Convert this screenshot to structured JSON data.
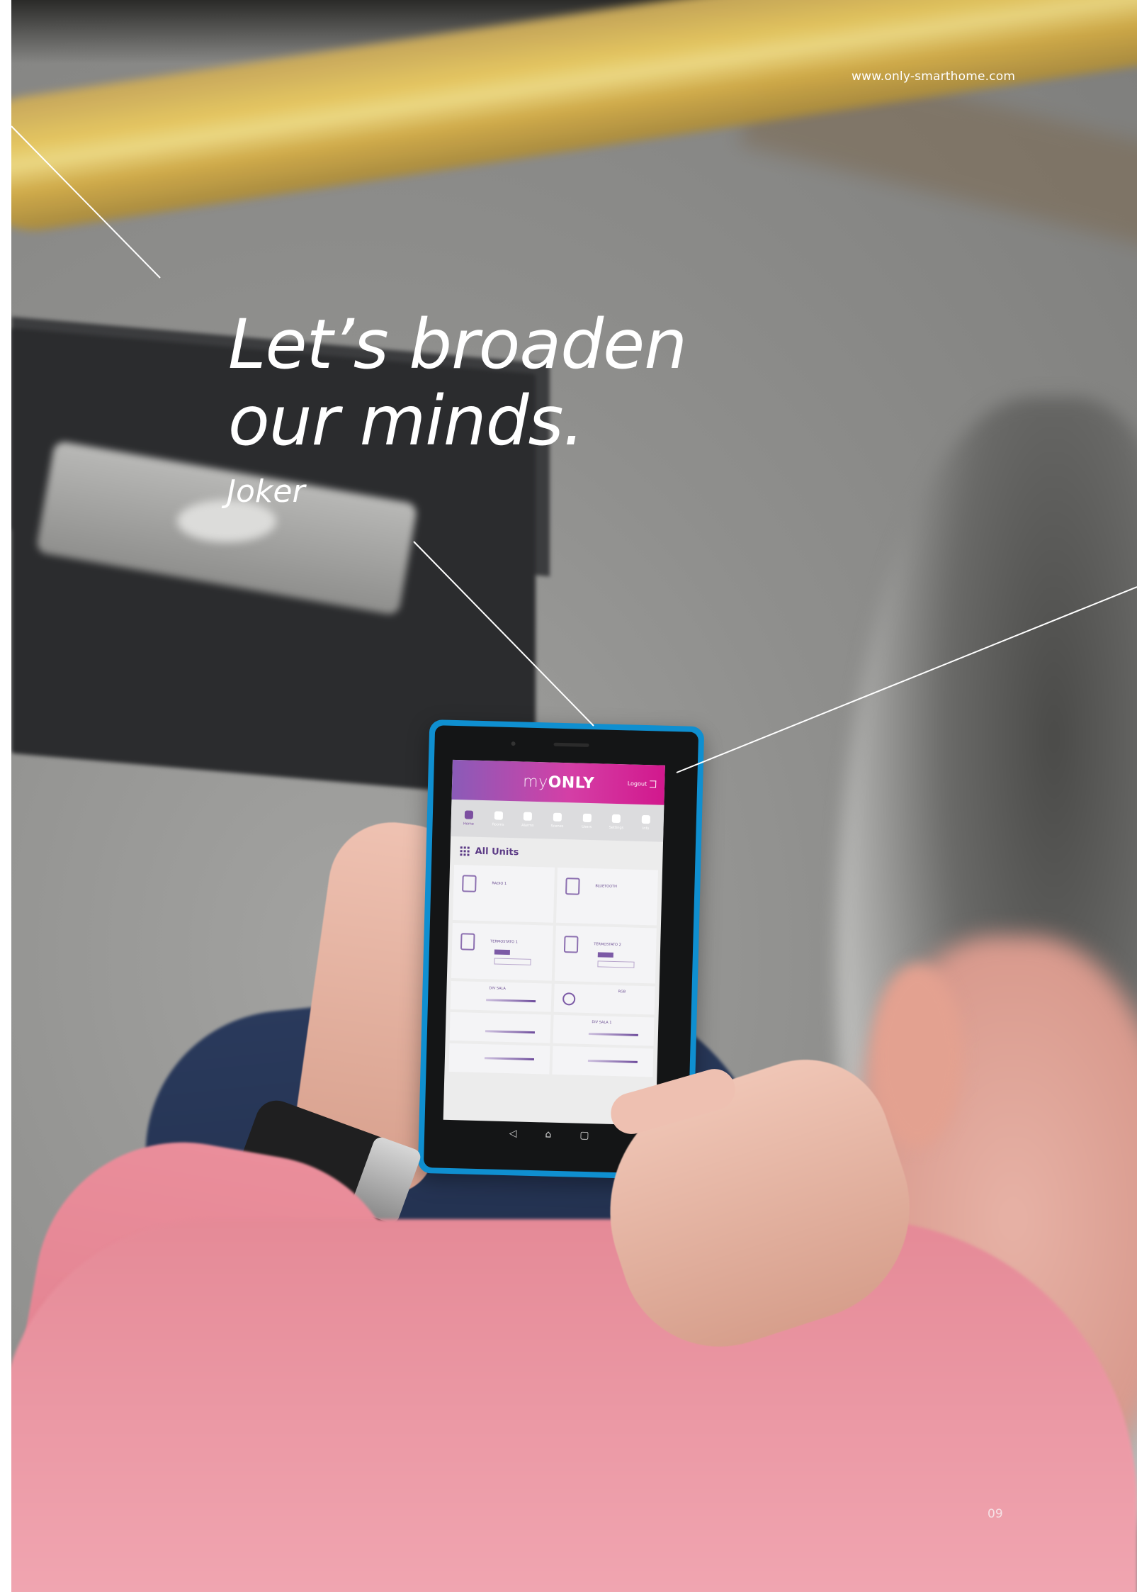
{
  "brochure": {
    "website": "www.only-smarthome.com",
    "headline_line1": "Let’s broaden",
    "headline_line2": "our minds.",
    "product_name": "Joker",
    "page_number": "09"
  },
  "tablet_app": {
    "logo_prefix": "my",
    "logo_brand": "ONLY",
    "logout_label": "Logout",
    "section_title": "All Units",
    "nav_items": [
      "Home",
      "Rooms",
      "Alarms",
      "Scenes",
      "Users",
      "Settings",
      "Info"
    ],
    "cards": [
      {
        "title": "RADIO 1"
      },
      {
        "title": "BLUETOOTH"
      },
      {
        "title": "TERMOSTATO 1"
      },
      {
        "title": "TERMOSTATO 2"
      },
      {
        "title": "DIV SALA"
      },
      {
        "title": "RGB"
      },
      {
        "title": ""
      },
      {
        "title": "DIV SALA 1"
      }
    ]
  },
  "colors": {
    "app_header_start": "#8a5bb8",
    "app_header_end": "#d2188d",
    "tablet_case": "#0f8fd0",
    "accent_purple": "#5c3b86"
  }
}
